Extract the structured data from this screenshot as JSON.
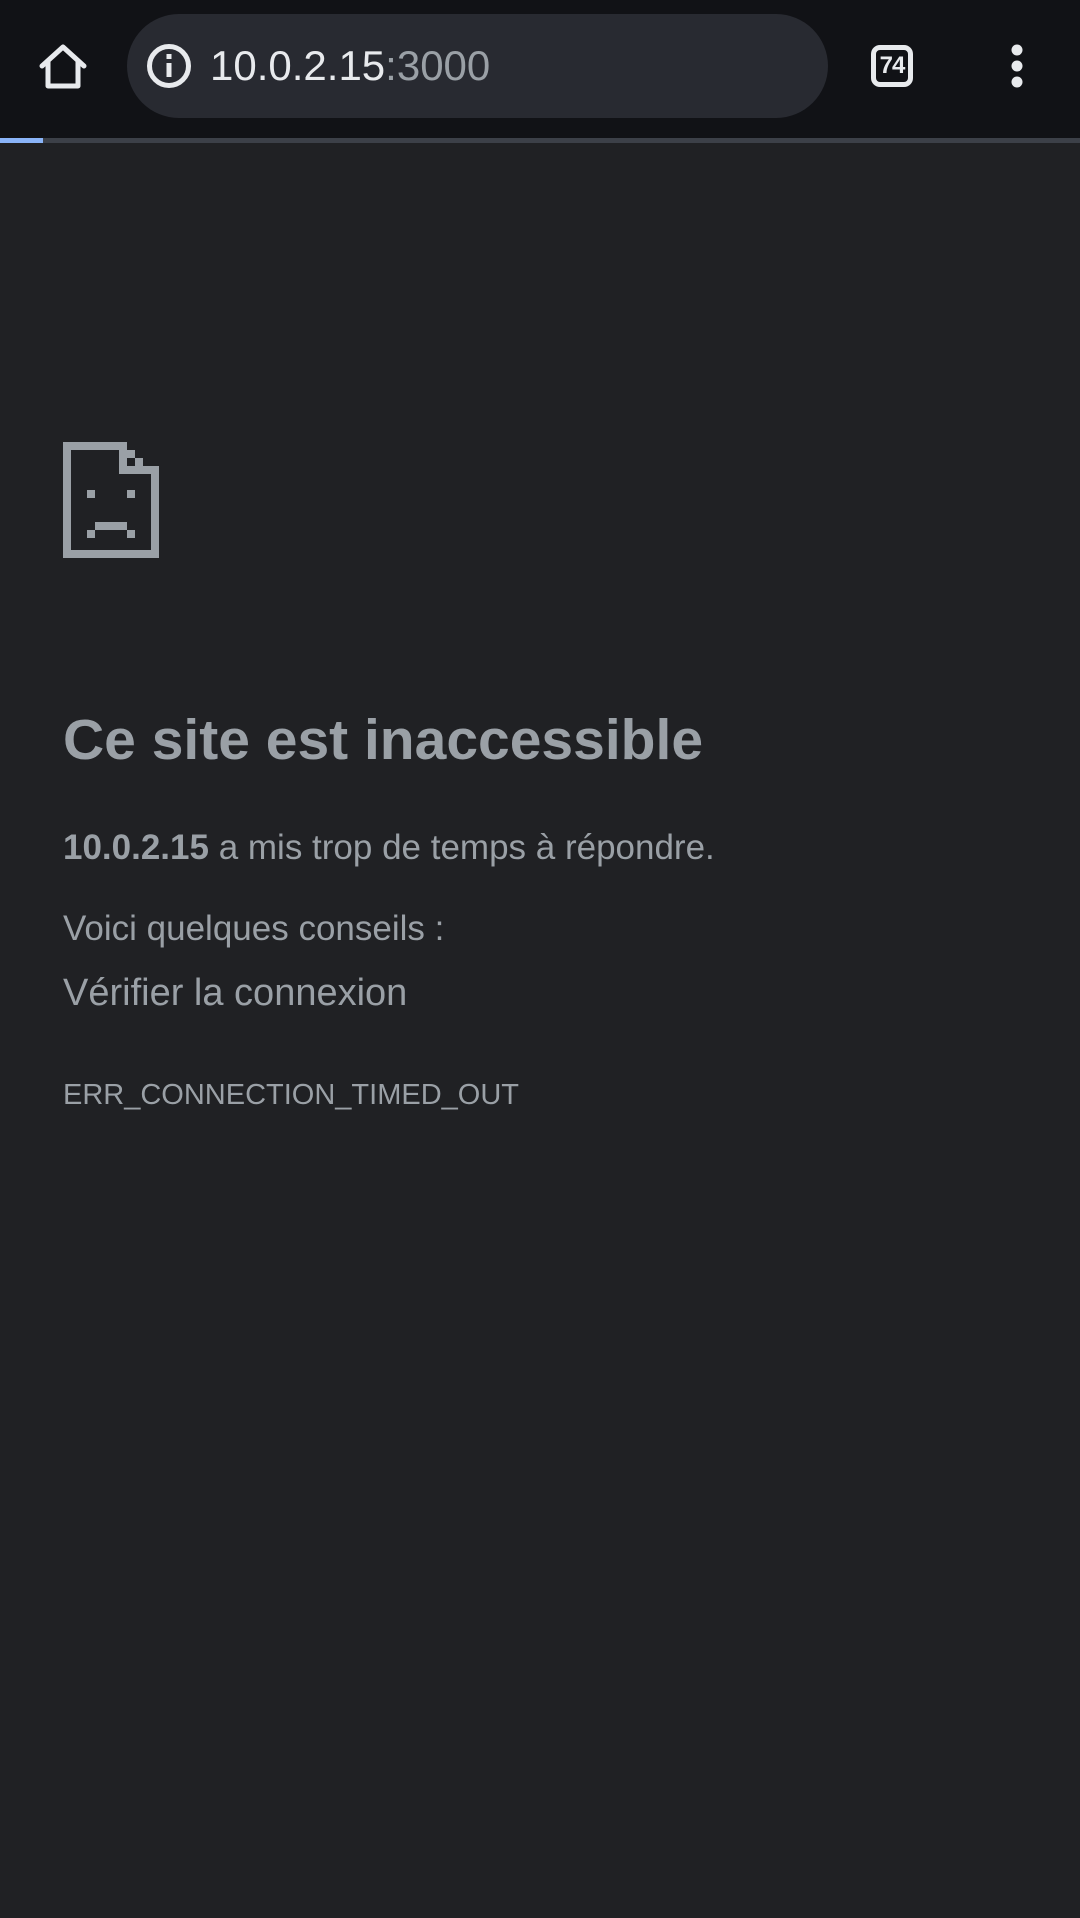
{
  "toolbar": {
    "home_icon": "home-icon",
    "info_icon": "info-icon",
    "url_host": "10.0.2.15",
    "url_port": ":3000",
    "tab_count": "74",
    "menu_icon": "more-vert-icon",
    "load_progress": 0.04
  },
  "error_page": {
    "icon": "sad-document-icon",
    "title": "Ce site est inaccessible",
    "host": "10.0.2.15",
    "description": " a mis trop de temps à répondre.",
    "tips_heading": "Voici quelques conseils :",
    "tips": [
      "Vérifier la connexion"
    ],
    "error_code": "ERR_CONNECTION_TIMED_OUT"
  },
  "colors": {
    "background": "#202124",
    "toolbar": "#111216",
    "omnibox": "#282a31",
    "text_primary": "#e8eaed",
    "text_secondary": "#9aa0a6",
    "progress": "#8ab4f8"
  }
}
